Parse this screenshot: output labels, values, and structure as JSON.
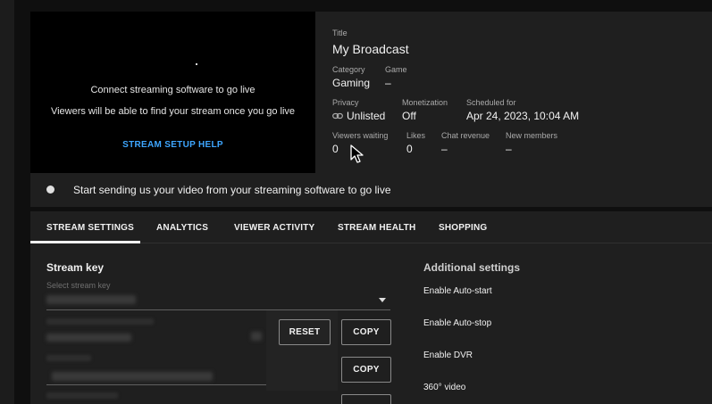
{
  "preview": {
    "message_primary": "Connect streaming software to go live",
    "message_secondary": "Viewers will be able to find your stream once you go live",
    "help_link": "STREAM SETUP HELP"
  },
  "details": {
    "title_label": "Title",
    "title_value": "My Broadcast",
    "category_label": "Category",
    "category_value": "Gaming",
    "game_label": "Game",
    "game_value": "–",
    "privacy_label": "Privacy",
    "privacy_value": "Unlisted",
    "monetization_label": "Monetization",
    "monetization_value": "Off",
    "scheduled_label": "Scheduled for",
    "scheduled_value": "Apr 24, 2023, 10:04 AM",
    "viewers_waiting_label": "Viewers waiting",
    "viewers_waiting_value": "0",
    "likes_label": "Likes",
    "likes_value": "0",
    "chat_revenue_label": "Chat revenue",
    "chat_revenue_value": "–",
    "new_members_label": "New members",
    "new_members_value": "–"
  },
  "status": {
    "text": "Start sending us your video from your streaming software to go live"
  },
  "tabs": [
    {
      "label": "STREAM SETTINGS",
      "active": true
    },
    {
      "label": "ANALYTICS",
      "active": false
    },
    {
      "label": "VIEWER ACTIVITY",
      "active": false
    },
    {
      "label": "STREAM HEALTH",
      "active": false
    },
    {
      "label": "SHOPPING",
      "active": false
    }
  ],
  "stream_key": {
    "title": "Stream key",
    "select_placeholder": "Select stream key",
    "reset_label": "RESET",
    "copy_label": "COPY",
    "copy_label_2": "COPY"
  },
  "additional_settings": {
    "title": "Additional settings",
    "items": [
      "Enable Auto-start",
      "Enable Auto-stop",
      "Enable DVR",
      "360° video"
    ]
  },
  "icons": {
    "privacy": "link-icon",
    "dropdown": "chevron-down-icon",
    "status": "status-dot-icon",
    "cursor": "mouse-pointer-icon"
  },
  "colors": {
    "accent": "#3ea6ff",
    "background": "#0f0f0f",
    "panel": "#1f1f1f"
  }
}
